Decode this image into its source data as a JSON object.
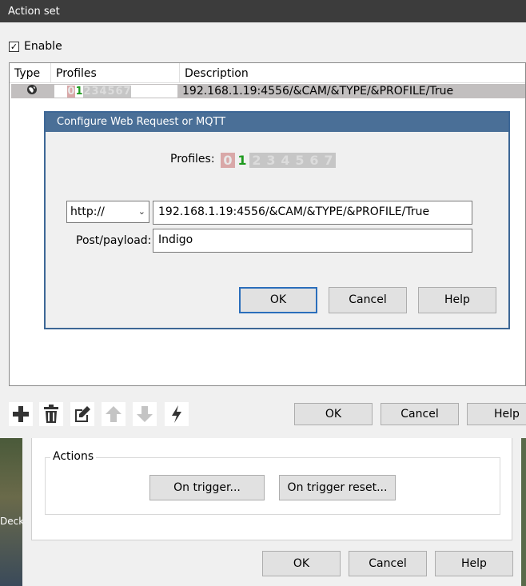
{
  "window": {
    "title": "Action set"
  },
  "enable": {
    "label": "Enable",
    "checked": true
  },
  "list": {
    "columns": [
      "Type",
      "Profiles",
      "Description"
    ],
    "rows": [
      {
        "type_icon": "globe-icon",
        "profiles": [
          "0",
          "1",
          "2",
          "3",
          "4",
          "5",
          "6",
          "7"
        ],
        "description": "192.168.1.19:4556/&CAM/&TYPE/&PROFILE/True"
      }
    ]
  },
  "dialog": {
    "title": "Configure Web Request or MQTT",
    "profiles_label": "Profiles:",
    "profiles": [
      "0",
      "1",
      "2",
      "3",
      "4",
      "5",
      "6",
      "7"
    ],
    "active_profile": "1",
    "protocol": "http://",
    "url": "192.168.1.19:4556/&CAM/&TYPE/&PROFILE/True",
    "payload_label": "Post/payload:",
    "payload": "Indigo",
    "ok": "OK",
    "cancel": "Cancel",
    "help": "Help"
  },
  "toolbar": {
    "icons": [
      "add-icon",
      "delete-icon",
      "edit-icon",
      "move-up-icon",
      "move-down-icon",
      "test-icon"
    ],
    "ok": "OK",
    "cancel": "Cancel",
    "help": "Help"
  },
  "background": {
    "side_label": "Deck",
    "actions_group": "Actions",
    "on_trigger": "On trigger...",
    "on_trigger_reset": "On trigger reset...",
    "ok": "OK",
    "cancel": "Cancel",
    "help": "Help"
  },
  "colors": {
    "titlebar": "#3c3c3c",
    "dialog_title": "#4a6f97",
    "selected_row": "#c2bfbf",
    "active_profile": "#1e9a1e"
  }
}
